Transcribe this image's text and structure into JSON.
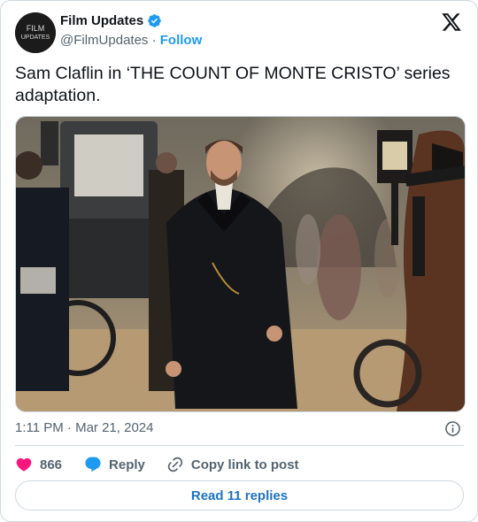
{
  "author": {
    "name": "Film Updates",
    "handle": "@FilmUpdates",
    "separator": "·",
    "follow_label": "Follow",
    "verified_color": "#1d9bf0",
    "avatar_text_line1": "FILM",
    "avatar_text_line2": "UPDATES"
  },
  "tweet": {
    "text": "Sam Claflin in ‘THE COUNT OF MONTE CRISTO’ series adaptation.",
    "time": "1:11 PM",
    "separator": "·",
    "date": "Mar 21, 2024"
  },
  "actions": {
    "like_count": "866",
    "reply_label": "Reply",
    "copy_label": "Copy link to post",
    "like_icon_color": "#f91880",
    "reply_icon_color": "#1d9bf0"
  },
  "footer": {
    "read_replies_label": "Read 11 replies"
  },
  "icons": {
    "brand": "x-logo-icon",
    "info": "info-icon",
    "like": "heart-icon",
    "reply": "speech-bubble-icon",
    "copy": "link-icon"
  },
  "colors": {
    "link": "#1d9bf0",
    "secondary_text": "#536471",
    "border": "#cfd9de"
  }
}
